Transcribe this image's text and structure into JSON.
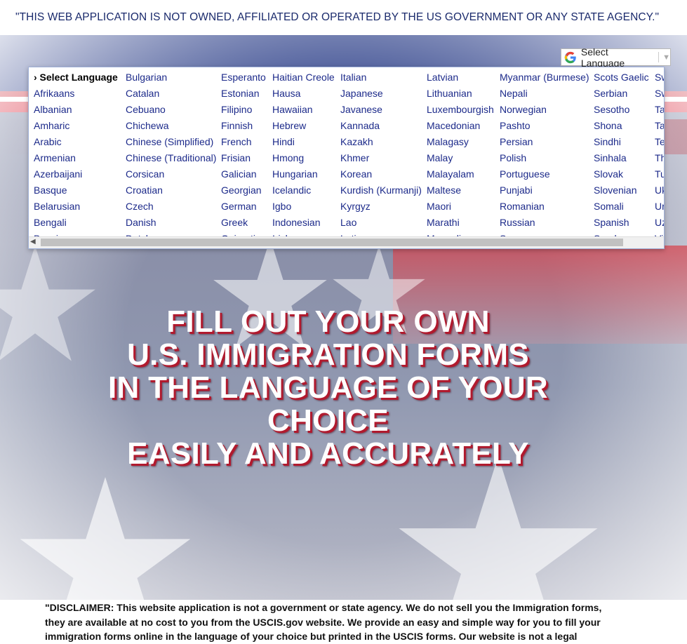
{
  "top_notice": "\"THIS WEB APPLICATION IS NOT OWNED, AFFILIATED OR OPERATED BY THE US GOVERNMENT OR ANY STATE AGENCY.\"",
  "translate_widget": {
    "label": "Select Language",
    "icon": "google-g-icon",
    "caret": "▼"
  },
  "language_menu": {
    "selected_marker": "›",
    "columns": [
      [
        "Select Language",
        "Afrikaans",
        "Albanian",
        "Amharic",
        "Arabic",
        "Armenian",
        "Azerbaijani",
        "Basque",
        "Belarusian",
        "Bengali",
        "Bosnian"
      ],
      [
        "Bulgarian",
        "Catalan",
        "Cebuano",
        "Chichewa",
        "Chinese (Simplified)",
        "Chinese (Traditional)",
        "Corsican",
        "Croatian",
        "Czech",
        "Danish",
        "Dutch"
      ],
      [
        "Esperanto",
        "Estonian",
        "Filipino",
        "Finnish",
        "French",
        "Frisian",
        "Galician",
        "Georgian",
        "German",
        "Greek",
        "Gujarati"
      ],
      [
        "Haitian Creole",
        "Hausa",
        "Hawaiian",
        "Hebrew",
        "Hindi",
        "Hmong",
        "Hungarian",
        "Icelandic",
        "Igbo",
        "Indonesian",
        "Irish"
      ],
      [
        "Italian",
        "Japanese",
        "Javanese",
        "Kannada",
        "Kazakh",
        "Khmer",
        "Korean",
        "Kurdish (Kurmanji)",
        "Kyrgyz",
        "Lao",
        "Latin"
      ],
      [
        "Latvian",
        "Lithuanian",
        "Luxembourgish",
        "Macedonian",
        "Malagasy",
        "Malay",
        "Malayalam",
        "Maltese",
        "Maori",
        "Marathi",
        "Mongolian"
      ],
      [
        "Myanmar (Burmese)",
        "Nepali",
        "Norwegian",
        "Pashto",
        "Persian",
        "Polish",
        "Portuguese",
        "Punjabi",
        "Romanian",
        "Russian",
        "Samoan"
      ],
      [
        "Scots Gaelic",
        "Serbian",
        "Sesotho",
        "Shona",
        "Sindhi",
        "Sinhala",
        "Slovak",
        "Slovenian",
        "Somali",
        "Spanish",
        "Sundanese"
      ],
      [
        "Swahili",
        "Swedish",
        "Tajik",
        "Tamil",
        "Telugu",
        "Thai",
        "Turkish",
        "Ukrainian",
        "Urdu",
        "Uzbek",
        "Vietnamese"
      ]
    ]
  },
  "hero": {
    "lines": [
      "FILL OUT YOUR OWN",
      "U.S. IMMIGRATION FORMS",
      "IN THE LANGUAGE OF YOUR",
      "CHOICE",
      "EASILY AND ACCURATELY"
    ]
  },
  "disclaimer": {
    "lines": [
      "\"DISCLAIMER: This website application is not a government or state agency. We do not sell you the Immigration forms,",
      "they are available at no cost to you from the USCIS.gov website. We provide an easy and simple way for you to fill your",
      "immigration forms online in the language of your choice but printed in the USCIS forms. Our website is not a legal"
    ]
  },
  "colors": {
    "navy": "#152a7c",
    "red": "#c81e2e",
    "link_blue": "#1c2a8a"
  }
}
